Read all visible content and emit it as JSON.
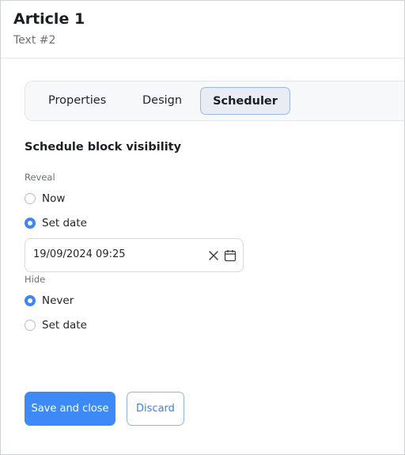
{
  "header": {
    "title": "Article 1",
    "subtitle": "Text #2"
  },
  "tabs": [
    {
      "label": "Properties",
      "active": false
    },
    {
      "label": "Design",
      "active": false
    },
    {
      "label": "Scheduler",
      "active": true
    }
  ],
  "scheduler": {
    "section_title": "Schedule block visibility",
    "reveal": {
      "label": "Reveal",
      "options": [
        {
          "label": "Now",
          "checked": false
        },
        {
          "label": "Set date",
          "checked": true
        }
      ],
      "date_value": "19/09/2024 09:25"
    },
    "hide": {
      "label": "Hide",
      "options": [
        {
          "label": "Never",
          "checked": true
        },
        {
          "label": "Set date",
          "checked": false
        }
      ]
    }
  },
  "actions": {
    "save_label": "Save and close",
    "discard_label": "Discard"
  },
  "colors": {
    "accent": "#3d8af7",
    "tab_active_bg": "#e9ecf5",
    "tab_active_border": "#9cb7ea"
  },
  "icons": {
    "clear": "close-icon",
    "calendar": "calendar-icon"
  }
}
